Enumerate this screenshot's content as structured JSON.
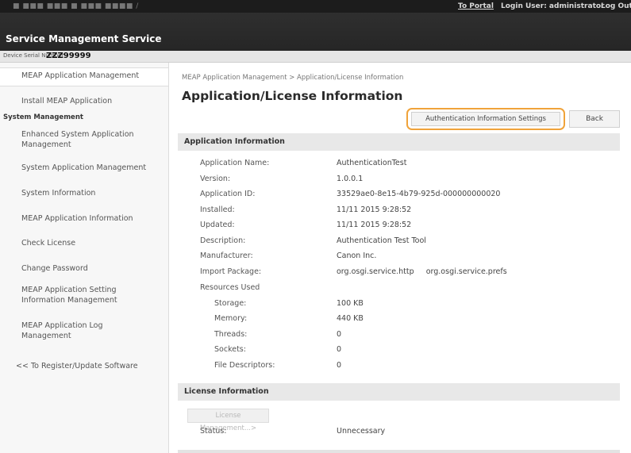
{
  "topbar": {
    "device": "■ ■■■ ■■■ ■ ■■■ ■■■■ /",
    "portal_link": "To Portal",
    "login_user": "Login User: administrator",
    "logout": "Log Out"
  },
  "title": "Service Management Service",
  "serial": {
    "label": "Device Serial Number",
    "value": "ZZZ99999"
  },
  "sidebar": {
    "items": [
      "MEAP Application Management",
      "Install MEAP Application",
      "System Management",
      "Enhanced System Application Management",
      "System Application Management",
      "System Information",
      "MEAP Application Information",
      "Check License",
      "Change Password",
      "MEAP Application Setting Information Management",
      "MEAP Application Log Management",
      "<< To Register/Update Software"
    ]
  },
  "breadcrumb": "MEAP Application Management > Application/License Information",
  "page_title": "Application/License Information",
  "buttons": {
    "auth": "Authentication Information Settings",
    "back": "Back"
  },
  "app_info": {
    "header": "Application Information",
    "rows": [
      {
        "label": "Application Name:",
        "value": "AuthenticationTest"
      },
      {
        "label": "Version:",
        "value": "1.0.0.1"
      },
      {
        "label": "Application ID:",
        "value": "33529ae0-8e15-4b79-925d-000000000020"
      },
      {
        "label": "Installed:",
        "value": "11/11 2015 9:28:52"
      },
      {
        "label": "Updated:",
        "value": "11/11 2015 9:28:52"
      },
      {
        "label": "Description:",
        "value": "Authentication Test Tool"
      },
      {
        "label": "Manufacturer:",
        "value": "Canon Inc."
      },
      {
        "label": "Import Package:",
        "value": "org.osgi.service.http     org.osgi.service.prefs"
      },
      {
        "label": "Resources Used",
        "value": ""
      }
    ],
    "resources": [
      {
        "label": "Storage:",
        "value": "100 KB"
      },
      {
        "label": "Memory:",
        "value": "440 KB"
      },
      {
        "label": "Threads:",
        "value": "0"
      },
      {
        "label": "Sockets:",
        "value": "0"
      },
      {
        "label": "File Descriptors:",
        "value": "0"
      }
    ]
  },
  "license_info": {
    "header": "License Information",
    "button": "License Management...>",
    "status_label": "Status:",
    "status_value": "Unnecessary"
  }
}
